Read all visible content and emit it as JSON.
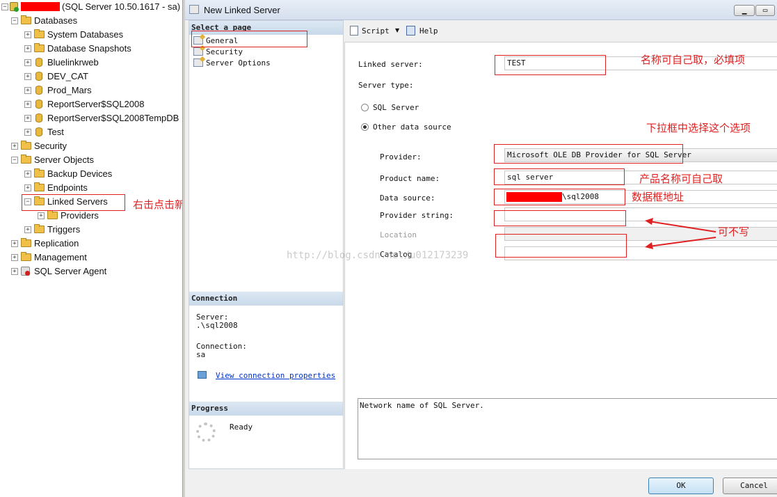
{
  "tree": {
    "root_label": "(SQL Server 10.50.1617 - sa)",
    "nodes": [
      {
        "label": "Databases",
        "level": 1,
        "icon": "folder-icon",
        "exp": "−"
      },
      {
        "label": "System Databases",
        "level": 2,
        "icon": "folder-icon",
        "exp": "+"
      },
      {
        "label": "Database Snapshots",
        "level": 2,
        "icon": "folder-icon",
        "exp": "+"
      },
      {
        "label": "Bluelinkrweb",
        "level": 2,
        "icon": "database-icon",
        "exp": "+"
      },
      {
        "label": "DEV_CAT",
        "level": 2,
        "icon": "database-icon",
        "exp": "+"
      },
      {
        "label": "Prod_Mars",
        "level": 2,
        "icon": "database-icon",
        "exp": "+"
      },
      {
        "label": "ReportServer$SQL2008",
        "level": 2,
        "icon": "database-icon",
        "exp": "+"
      },
      {
        "label": "ReportServer$SQL2008TempDB",
        "level": 2,
        "icon": "database-icon",
        "exp": "+"
      },
      {
        "label": "Test",
        "level": 2,
        "icon": "database-icon",
        "exp": "+"
      },
      {
        "label": "Security",
        "level": 1,
        "icon": "folder-icon",
        "exp": "+"
      },
      {
        "label": "Server Objects",
        "level": 1,
        "icon": "folder-icon",
        "exp": "−"
      },
      {
        "label": "Backup Devices",
        "level": 2,
        "icon": "folder-icon",
        "exp": "+"
      },
      {
        "label": "Endpoints",
        "level": 2,
        "icon": "folder-icon",
        "exp": "+"
      },
      {
        "label": "Linked Servers",
        "level": 2,
        "icon": "folder-icon",
        "exp": "−"
      },
      {
        "label": "Providers",
        "level": 3,
        "icon": "folder-icon",
        "exp": "+"
      },
      {
        "label": "Triggers",
        "level": 2,
        "icon": "folder-icon",
        "exp": "+"
      },
      {
        "label": "Replication",
        "level": 1,
        "icon": "folder-icon",
        "exp": "+"
      },
      {
        "label": "Management",
        "level": 1,
        "icon": "folder-icon",
        "exp": "+"
      },
      {
        "label": "SQL Server Agent",
        "level": 1,
        "icon": "agent-icon",
        "exp": "+"
      }
    ]
  },
  "dialog": {
    "title": "New Linked Server",
    "select_page_header": "Select a page",
    "pages": [
      "General",
      "Security",
      "Server Options"
    ],
    "toolbar": {
      "script_label": "Script",
      "help_label": "Help"
    },
    "connection": {
      "header": "Connection",
      "server_label": "Server:",
      "server_value": ".\\sql2008",
      "conn_label": "Connection:",
      "conn_value": "sa",
      "view_link": "View connection properties"
    },
    "progress": {
      "header": "Progress",
      "status": "Ready"
    },
    "form": {
      "linked_server_label": "Linked server:",
      "linked_server_value": "TEST",
      "server_type_label": "Server type:",
      "sql_server_radio": "SQL Server",
      "other_radio": "Other data source",
      "provider_label": "Provider:",
      "provider_value": "Microsoft OLE DB Provider for SQL Server",
      "product_name_label": "Product name:",
      "product_name_value": "sql server",
      "data_source_label": "Data source:",
      "data_source_value": "\\sql2008",
      "provider_string_label": "Provider string:",
      "location_label": "Location",
      "catalog_label": "Catalog",
      "description": "Network name of SQL Server."
    },
    "buttons": {
      "ok": "OK",
      "cancel": "Cancel"
    }
  },
  "annotations": {
    "right_click": "右击点击新建",
    "name_required": "名称可自己取，必填项",
    "dropdown": "下拉框中选择这个选项",
    "product_name": "产品名称可自己取",
    "data_source": "数据框地址",
    "optional": "可不写"
  },
  "watermark": "http://blog.csdn.net/u012173239",
  "colors": {
    "annotation": "#e02020",
    "panel_header": "#c9d9ea",
    "redaction": "#ff0000"
  }
}
